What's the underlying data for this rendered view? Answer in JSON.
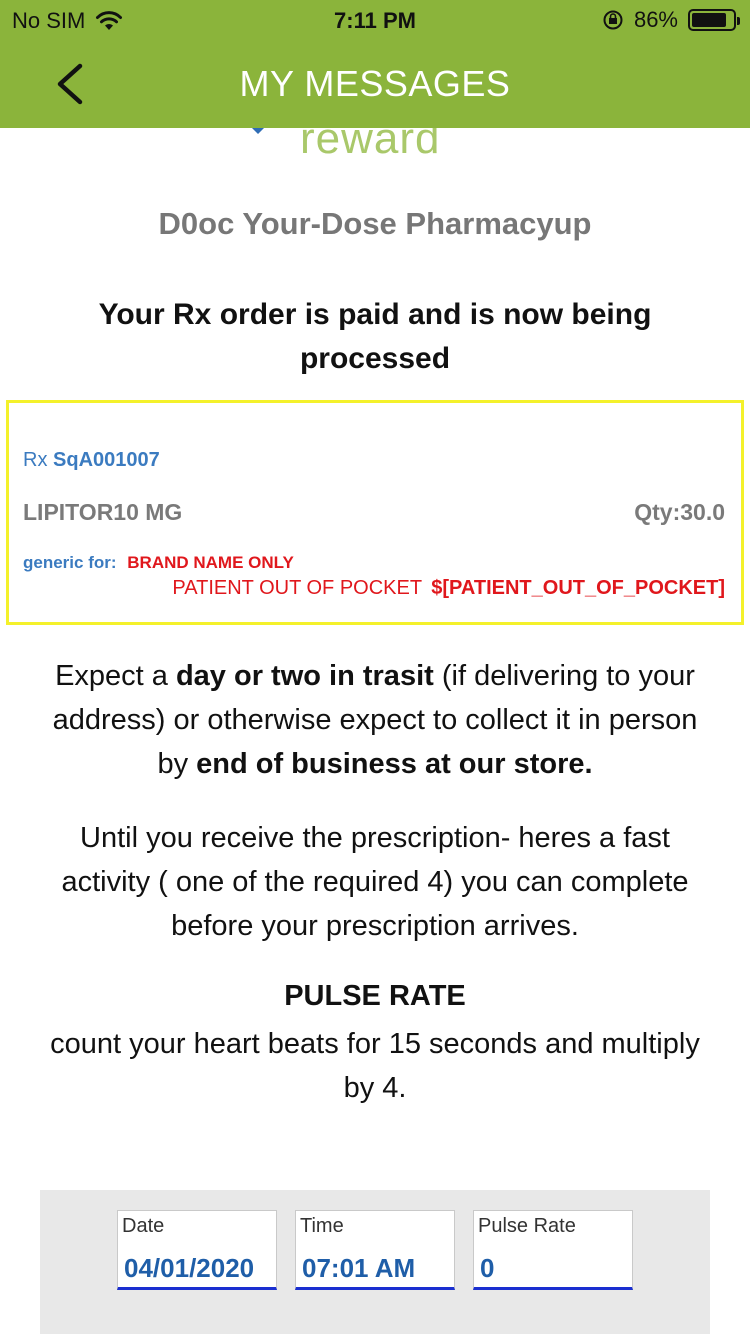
{
  "status_bar": {
    "carrier": "No SIM",
    "time": "7:11 PM",
    "battery_percent": "86%",
    "battery_level": 0.86,
    "icons": [
      "wifi-icon",
      "orientation-lock-icon",
      "battery-icon"
    ]
  },
  "nav": {
    "title": "MY MESSAGES",
    "back_icon": "chevron-left-icon"
  },
  "logo": {
    "word": "reward",
    "mark": "SM"
  },
  "pharmacy_name": "D0oc Your-Dose Pharmacyup",
  "headline": "Your Rx order is paid and is now being processed",
  "rx": {
    "prefix": "Rx",
    "number": "SqA001007",
    "drug": "LIPITOR10 MG",
    "qty": "Qty:30.0",
    "generic_label": "generic for:",
    "generic_value": "BRAND NAME ONLY",
    "oop_label": "PATIENT OUT OF POCKET",
    "oop_value": "$[PATIENT_OUT_OF_POCKET]"
  },
  "paragraph1": {
    "a": "Expect a ",
    "b": "day or two in trasit",
    "c": " (if delivering to your address) or otherwise expect to collect it in person by ",
    "d": "end of business at our store."
  },
  "paragraph2": "Until you receive the prescription- heres a fast activity ( one of the required 4) you can complete before your prescription arrives.",
  "pulse": {
    "title": "PULSE RATE",
    "description": "count your heart beats for 15 seconds and multiply by 4."
  },
  "form": {
    "date_label": "Date",
    "date_value": "04/01/2020",
    "time_label": "Time",
    "time_value": "07:01 AM",
    "pulse_label": "Pulse Rate",
    "pulse_value": "0"
  },
  "colors": {
    "brand_green": "#8bb43b",
    "logo_green": "#a9c86a",
    "link_blue": "#3b7bc0",
    "alert_red": "#e0171c",
    "highlight_yellow": "#f4f12a"
  }
}
